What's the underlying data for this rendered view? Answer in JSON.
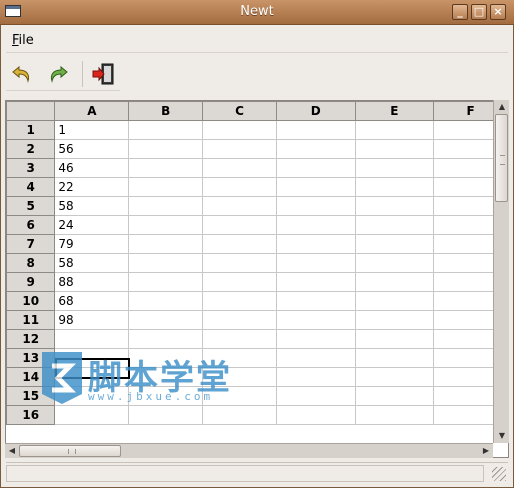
{
  "window": {
    "title": "Newt"
  },
  "menubar": {
    "file_label": "File",
    "file_mnemonic": "F",
    "file_rest": "ile"
  },
  "toolbar": {
    "undo_icon": "undo-icon",
    "redo_icon": "redo-icon",
    "quit_icon": "quit-icon"
  },
  "sheet": {
    "columns": [
      "A",
      "B",
      "C",
      "D",
      "E",
      "F"
    ],
    "rows": [
      {
        "num": "1",
        "A": "1"
      },
      {
        "num": "2",
        "A": "56"
      },
      {
        "num": "3",
        "A": "46"
      },
      {
        "num": "4",
        "A": "22"
      },
      {
        "num": "5",
        "A": "58"
      },
      {
        "num": "6",
        "A": "24"
      },
      {
        "num": "7",
        "A": "79"
      },
      {
        "num": "8",
        "A": "58"
      },
      {
        "num": "9",
        "A": "88"
      },
      {
        "num": "10",
        "A": "68"
      },
      {
        "num": "11",
        "A": "98"
      },
      {
        "num": "12",
        "A": ""
      },
      {
        "num": "13",
        "A": ""
      },
      {
        "num": "14",
        "A": ""
      },
      {
        "num": "15",
        "A": ""
      },
      {
        "num": "16",
        "A": ""
      }
    ],
    "selected_cell": "A13"
  },
  "watermark": {
    "text": "脚本学堂",
    "url": "www.jbxue.com"
  },
  "colors": {
    "titlebar": "#b27a4c",
    "header_bg": "#dcd8d3",
    "watermark": "#3d8fc9"
  }
}
